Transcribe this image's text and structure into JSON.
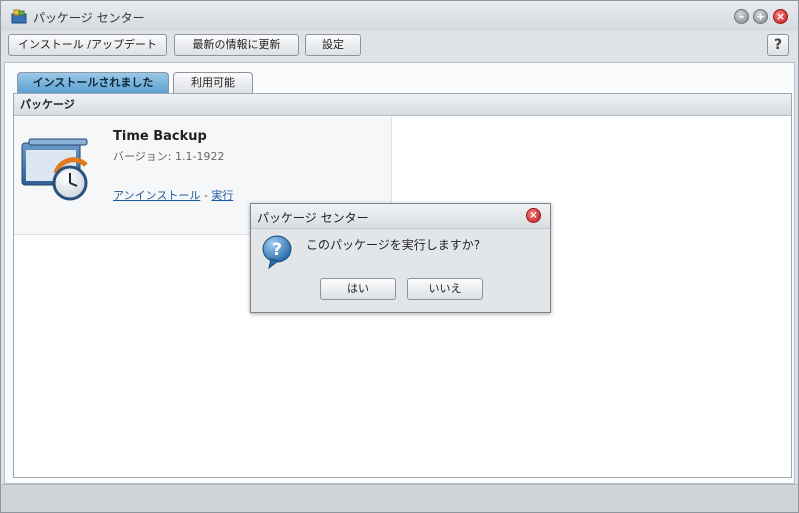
{
  "window": {
    "title": "パッケージ センター",
    "controls": {
      "minimize_icon": "minimize-icon",
      "maximize_icon": "plus-icon",
      "close_icon": "close-icon"
    }
  },
  "toolbar": {
    "install_update_label": "インストール /アップデート",
    "refresh_label": "最新の情報に更新",
    "settings_label": "設定",
    "help_label": "?"
  },
  "tabs": [
    {
      "label": "インストールされました",
      "active": true
    },
    {
      "label": "利用可能",
      "active": false
    }
  ],
  "panel": {
    "header": "パッケージ",
    "packages": [
      {
        "name": "Time Backup",
        "version": "バージョン: 1.1-1922",
        "uninstall_label": "アンインストール",
        "separator": "-",
        "run_label": "実行"
      }
    ]
  },
  "dialog": {
    "title": "パッケージ センター",
    "message": "このパッケージを実行しますか?",
    "yes_label": "はい",
    "no_label": "いいえ"
  },
  "colors": {
    "active_tab": "#5c9fcf",
    "link": "#1c5aa0",
    "close_red": "#c0191c"
  }
}
